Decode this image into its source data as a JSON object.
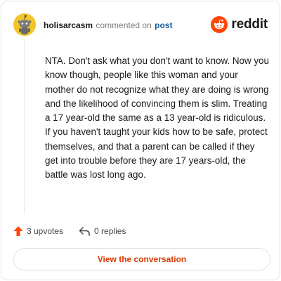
{
  "header": {
    "username": "holisarcasm",
    "commented_text": "commented on",
    "post_link": "post",
    "brand": "reddit"
  },
  "comment": {
    "body": "NTA. Don't ask what you don't want to know. Now you know though, people like this woman and your mother do not recognize what they are doing is wrong and the likelihood of convincing them is slim. Treating a 17 year-old the same as a 13 year-old is ridiculous. If you haven't taught your kids how to be safe, protect themselves, and that a parent can be called if they get into trouble before they are 17 years-old, the battle was lost long ago."
  },
  "actions": {
    "upvotes": "3 upvotes",
    "replies": "0 replies"
  },
  "footer": {
    "view_button": "View the conversation"
  },
  "colors": {
    "accent": "#d93a00",
    "avatar_bg": "#f3c52b",
    "link": "#1a5e9a"
  },
  "icons": [
    "snoo-avatar-icon",
    "reddit-logo-icon",
    "upvote-icon",
    "reply-icon"
  ]
}
